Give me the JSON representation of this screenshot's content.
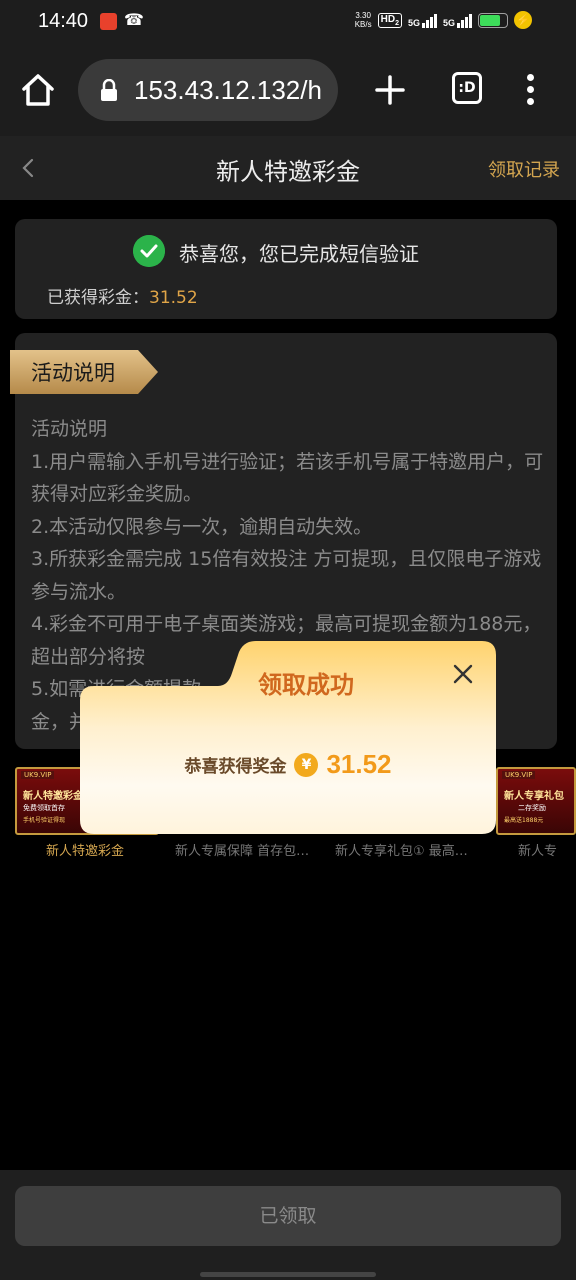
{
  "status_bar": {
    "time": "14:40",
    "net_speed_value": "3.30",
    "net_speed_unit": "KB/s",
    "hd_label": "HD",
    "hd_sub": "2",
    "sig1_label": "5G",
    "sig2_label": "5G",
    "icons": [
      "app-notification-icon",
      "call-forward-icon",
      "signal-icon",
      "battery-icon",
      "charging-icon"
    ]
  },
  "browser": {
    "url": "153.43.12.132/h",
    "tabs_label": ":D"
  },
  "header": {
    "title": "新人特邀彩金",
    "record_link": "领取记录"
  },
  "verify": {
    "message": "恭喜您，您已完成短信验证",
    "bonus_label": "已获得彩金：",
    "bonus_amount": "31.52"
  },
  "rules": {
    "tag": "活动说明",
    "heading": "活动说明",
    "items": [
      "1.用户需输入手机号进行验证；若该手机号属于特邀用户，可获得对应彩金奖励。",
      "2.本活动仅限参与一次，逾期自动失效。",
      "3.所获彩金需完成 15倍有效投注 方可提现，且仅限电子游戏参与流水。",
      "4.彩金不可用于电子桌面类游戏；最高可提现金额为188元，超出部分将按",
      "5.如需进行金额提款",
      "金，并"
    ]
  },
  "banners": [
    {
      "tag": "UK9.VIP",
      "title": "新人特邀彩金",
      "line1": "免费领取首存",
      "line2": "手机号验证得现",
      "caption": "新人特邀彩金"
    },
    {
      "caption": "新人专属保障 首存包…"
    },
    {
      "caption": "新人专享礼包① 最高…"
    },
    {
      "tag": "UK9.VIP",
      "title": "新人专享礼包",
      "line1": "二存奖励",
      "line2": "最高送1888元",
      "caption": "新人专"
    }
  ],
  "footer": {
    "button_label": "已领取"
  },
  "modal": {
    "title": "领取成功",
    "reward_label": "恭喜获得奖金",
    "currency_symbol": "¥",
    "reward_amount": "31.52"
  },
  "colors": {
    "accent_gold": "#d4a650",
    "amount_orange": "#e0a548",
    "success_green": "#2bb34a",
    "modal_title": "#d0681e"
  }
}
